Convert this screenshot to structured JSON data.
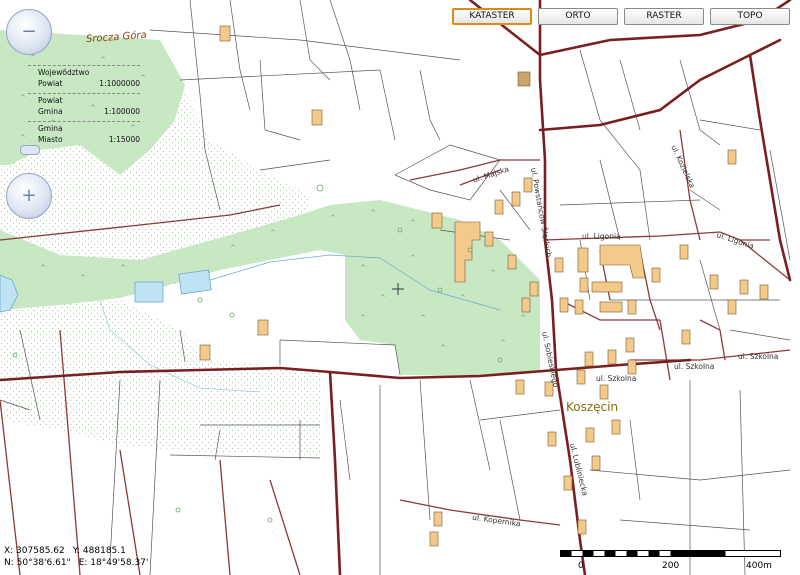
{
  "layers": {
    "buttons": [
      {
        "label": "KATASTER",
        "active": true
      },
      {
        "label": "ORTO",
        "active": false
      },
      {
        "label": "RASTER",
        "active": false
      },
      {
        "label": "TOPO",
        "active": false
      }
    ]
  },
  "controls": {
    "zoom_out_icon": "minus-icon",
    "pan_icon": "pan-crosshair-icon"
  },
  "scale_ladder": [
    {
      "level": "Województwo",
      "sub": "Powiat",
      "ratio": "1:1000000"
    },
    {
      "level": "Powiat",
      "sub": "Gmina",
      "ratio": "1:100000"
    },
    {
      "level": "Gmina",
      "sub": "Miasto",
      "ratio": "1:15000"
    }
  ],
  "labels": {
    "place_srocza": "Srocza Góra",
    "town": "Koszęcin",
    "street_majska": "ul. Majska",
    "street_ligonia_1": "ul. Ligonia",
    "street_ligonia_2": "ul. Ligonia",
    "street_koziejska": "ul. Kozielska",
    "street_szkolna_1": "ul. Szkolna",
    "street_szkolna_2": "ul. Szkolna",
    "street_szkolna_3": "ul. Szkolna",
    "street_kopernika": "ul. Kopernika",
    "street_powstancow": "ul. Powstańców Śląskich",
    "street_sobieskiego": "ul. Sobieskiego",
    "street_lubliniecka": "ul. Lubliniecka"
  },
  "coordinates": {
    "x": "X: 307585.62",
    "y": "Y: 488185.1",
    "n": "N: 50°38'6.61\"",
    "e": "E: 18°49'58.37'"
  },
  "scale_bar": {
    "ticks": [
      "0",
      "200",
      "400m"
    ]
  },
  "colors": {
    "forest": "#c8e8c4",
    "main_road": "#7a1f1f",
    "minor_road": "#8a3a3a",
    "parcel": "#555555",
    "building": "#f4c98c",
    "water": "#bfe3f2",
    "active_button": "#d98b1b"
  }
}
